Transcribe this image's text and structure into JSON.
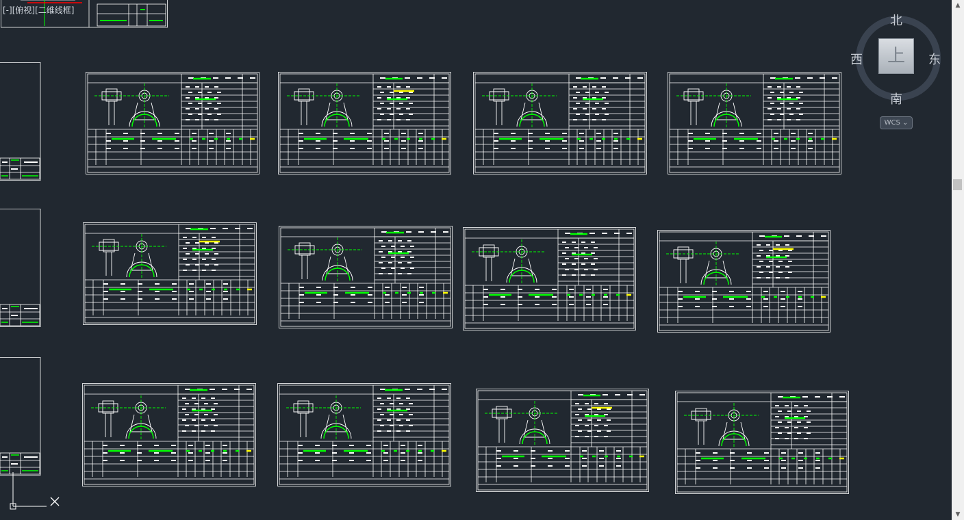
{
  "viewport": {
    "label_parts": [
      "[-]",
      "[俯视]",
      "[二维线框]"
    ],
    "background": "#212830"
  },
  "viewcube": {
    "north": "北",
    "south": "南",
    "west": "西",
    "east": "东",
    "top_face": "上",
    "wcs_label": "WCS",
    "wcs_arrow": "⌄"
  },
  "colors": {
    "line": "#ffffff",
    "accent_green": "#00ff00",
    "accent_yellow": "#ffff00",
    "accent_red": "#ff0000"
  },
  "icons": {
    "ucs": "ucs-icon",
    "crosshair": "crosshair-x-icon"
  },
  "scrollbar": {
    "up": "▲",
    "down": "▼"
  }
}
